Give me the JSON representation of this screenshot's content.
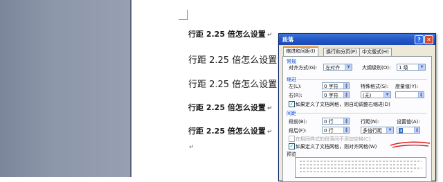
{
  "document": {
    "lines": [
      {
        "text": "行距 2.25 倍怎么设置"
      },
      {
        "text": "行距 2.25 倍怎么设置"
      },
      {
        "text": "行距 2.25 倍怎么设置"
      },
      {
        "text": "行距 2.25 倍怎么设置"
      },
      {
        "text": "行距 2.25 倍怎么设置"
      }
    ],
    "paragraph_mark": "↵"
  },
  "dialog": {
    "title": "段落",
    "help": "?",
    "close": "✕",
    "tabs": [
      "缩进和间距(I)",
      "换行和分页(P)",
      "中文版式(H)"
    ],
    "general": {
      "section": "常规",
      "alignment_label": "对齐方式(G):",
      "alignment_value": "左对齐",
      "outline_label": "大纲级别(O):",
      "outline_value": "1 级"
    },
    "indent": {
      "section": "缩进",
      "left_label": "左(L):",
      "left_value": "0 字符",
      "right_label": "右(R):",
      "right_value": "0 字符",
      "special_label": "特殊格式(S):",
      "special_value": "(无)",
      "by_label": "度量值(Y):",
      "auto_adjust": "如果定义了文档网格，则自动调整右缩进(D)"
    },
    "spacing": {
      "section": "间距",
      "before_label": "段前(B):",
      "before_value": "0 行",
      "after_label": "段后(F):",
      "after_value": "0 行",
      "line_label": "行距(N):",
      "line_value": "多倍行距",
      "at_label": "设置值(A):",
      "at_value": "3",
      "no_space_same_style": "在相同样式的段落间不添加空格(C)",
      "snap_to_grid": "如果定义了文档网格，则对齐网格(W)"
    },
    "preview": {
      "section": "预览"
    },
    "annotation_color": "#e02020"
  }
}
